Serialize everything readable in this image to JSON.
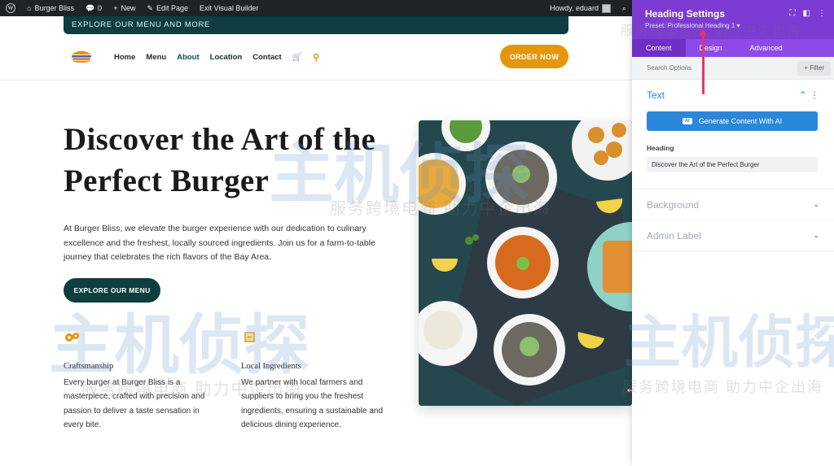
{
  "admin_bar": {
    "site": "Burger Bliss",
    "comments": "0",
    "new": "New",
    "edit_page": "Edit Page",
    "exit_builder": "Exit Visual Builder",
    "greeting": "Howdy, eduard"
  },
  "site": {
    "banner": "EXPLORE OUR MENU AND MORE",
    "nav": [
      "Home",
      "Menu",
      "About",
      "Location",
      "Contact"
    ],
    "active_nav": "About",
    "order_button": "ORDER NOW"
  },
  "hero": {
    "title": "Discover the Art of the Perfect Burger",
    "text": "At Burger Bliss, we elevate the burger experience with our dedication to culinary excellence and the freshest, locally sourced ingredients. Join us for a farm-to-table journey that celebrates the rich flavors of the Bay Area.",
    "button": "EXPLORE OUR MENU"
  },
  "features": [
    {
      "title": "Craftsmanship",
      "text": "Every burger at Burger Bliss is a masterpiece, crafted with precision and passion to deliver a taste sensation in every bite."
    },
    {
      "title": "Local Ingredients",
      "text": "We partner with local farmers and suppliers to bring you the freshest ingredients, ensuring a sustainable and delicious dining experience."
    }
  ],
  "watermark": {
    "big": "主机侦探",
    "sub": "服务跨境电商  助力中企出海"
  },
  "panel": {
    "title": "Heading Settings",
    "subtitle": "Preset: Professional Heading 1 ▾",
    "tabs": [
      "Content",
      "Design",
      "Advanced"
    ],
    "active_tab": "Content",
    "search_placeholder": "Search Options",
    "filter": "+ Filter",
    "sections": {
      "text": "Text",
      "background": "Background",
      "admin_label": "Admin Label"
    },
    "ai_badge": "AI",
    "ai_button": "Generate Content With AI",
    "heading_label": "Heading",
    "heading_value": "Discover the Art of the Perfect Burger"
  },
  "colors": {
    "brand_dark": "#0e3e40",
    "accent_orange": "#e5960c",
    "panel_purple": "#7c3bd3",
    "ai_blue": "#2b87da",
    "annotation_arrow": "#e8356b"
  }
}
